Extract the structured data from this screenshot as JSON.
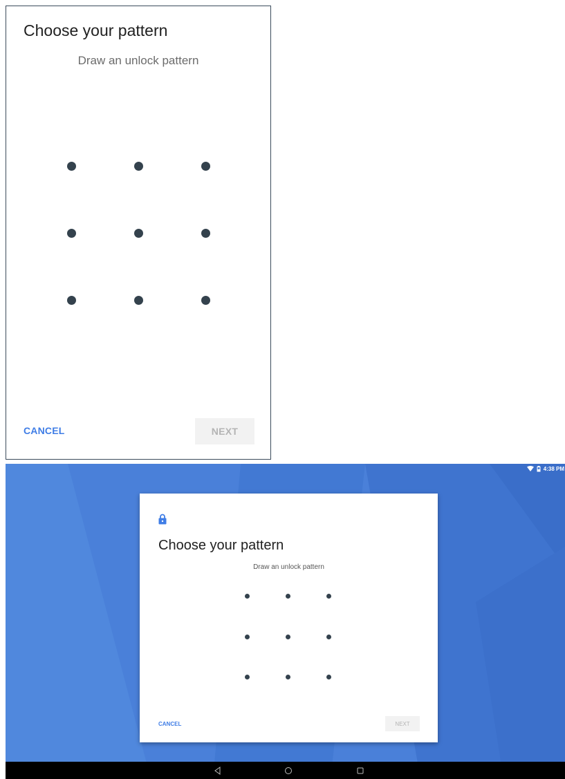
{
  "phone": {
    "title": "Choose your pattern",
    "subtitle": "Draw an unlock pattern",
    "cancel_label": "CANCEL",
    "next_label": "NEXT",
    "pattern_dot_count": 9
  },
  "tablet": {
    "status_bar": {
      "icons": [
        "wifi-icon",
        "battery-icon"
      ],
      "time": "4:38 PM"
    },
    "dialog": {
      "icon": "lock-icon",
      "title": "Choose your pattern",
      "subtitle": "Draw an unlock pattern",
      "cancel_label": "CANCEL",
      "next_label": "NEXT",
      "pattern_dot_count": 9
    },
    "nav_bar": {
      "buttons": [
        "back-icon",
        "home-icon",
        "recents-icon"
      ]
    }
  },
  "colors": {
    "accent": "#3f7de6",
    "dot": "#34424d",
    "wallpaper": "#4a80d9",
    "disabled_button_bg": "#f2f2f2",
    "disabled_button_text": "#b4b4b4"
  }
}
